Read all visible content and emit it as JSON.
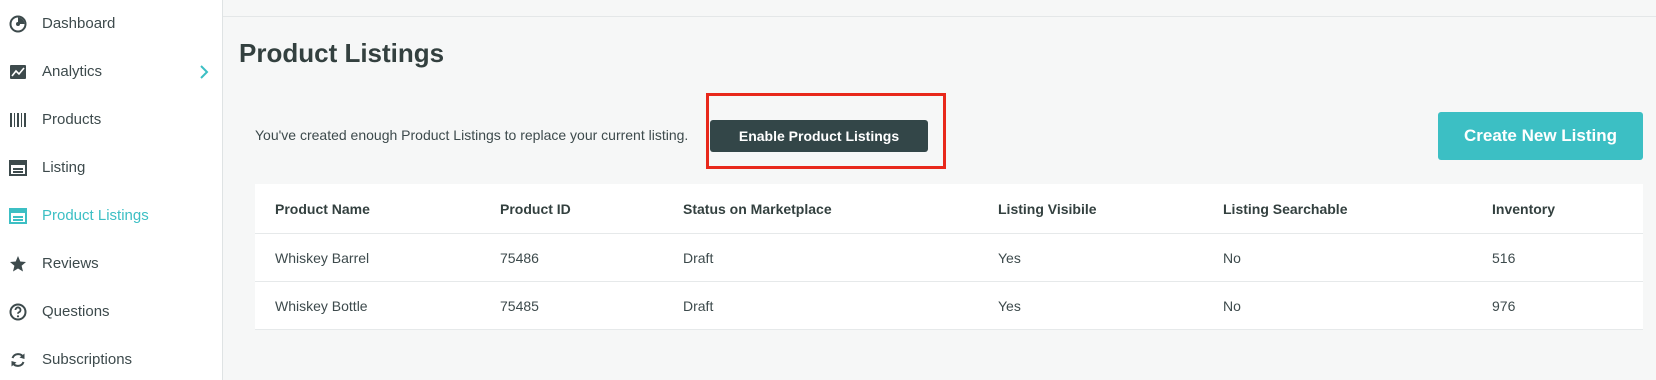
{
  "sidebar": {
    "items": [
      {
        "label": "Dashboard",
        "icon": "dashboard-gauge-icon"
      },
      {
        "label": "Analytics",
        "icon": "analytics-chart-icon",
        "has_submenu": true
      },
      {
        "label": "Products",
        "icon": "barcode-icon"
      },
      {
        "label": "Listing",
        "icon": "listing-icon"
      },
      {
        "label": "Product Listings",
        "icon": "product-listings-icon",
        "active": true
      },
      {
        "label": "Reviews",
        "icon": "star-icon"
      },
      {
        "label": "Questions",
        "icon": "question-circle-icon"
      },
      {
        "label": "Subscriptions",
        "icon": "refresh-icon"
      }
    ]
  },
  "main": {
    "title": "Product Listings",
    "notice": "You've created enough Product Listings to replace your current listing.",
    "enable_button": "Enable Product Listings",
    "create_button": "Create New Listing",
    "table": {
      "columns": [
        "Product Name",
        "Product ID",
        "Status on Marketplace",
        "Listing Visibile",
        "Listing Searchable",
        "Inventory"
      ],
      "rows": [
        [
          "Whiskey Barrel",
          "75486",
          "Draft",
          "Yes",
          "No",
          "516"
        ],
        [
          "Whiskey Bottle",
          "75485",
          "Draft",
          "Yes",
          "No",
          "976"
        ]
      ]
    }
  },
  "colors": {
    "accent": "#3cbfc4",
    "dark_button": "#334648",
    "highlight_border": "#e8281b"
  }
}
